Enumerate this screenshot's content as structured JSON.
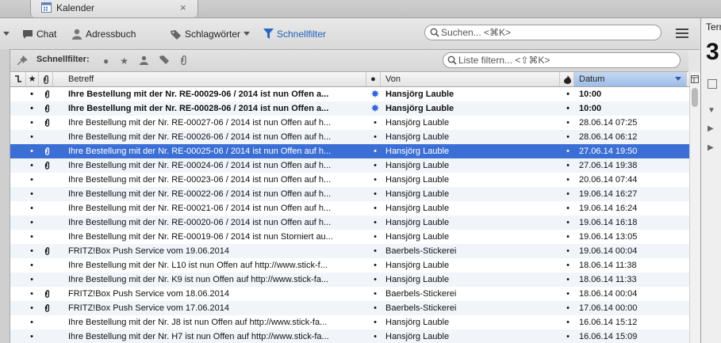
{
  "tab": {
    "title": "Kalender",
    "close": "×",
    "icon": "calendar-icon"
  },
  "toolbar": {
    "chat": "Chat",
    "addressbook": "Adressbuch",
    "tags": "Schlagwörter",
    "quickfilter": "Schnellfilter",
    "search_placeholder": "Suchen... <⌘K>"
  },
  "quickfilter_bar": {
    "label": "Schnellfilter:",
    "filter_placeholder": "Liste filtern... <⇧⌘K>"
  },
  "columns": {
    "subject": "Betreff",
    "from": "Von",
    "date": "Datum"
  },
  "colors": {
    "selection": "#3b6fd6",
    "accent": "#1f5fb8",
    "sorted_header": "#9dbde8"
  },
  "messages": [
    {
      "subject": "Ihre Bestellung mit der Nr. RE-00029-06 / 2014 ist nun Offen a...",
      "from": "Hansjörg Lauble",
      "date": "10:00",
      "bold": true,
      "attachment": true,
      "star": true
    },
    {
      "subject": "Ihre Bestellung mit der Nr. RE-00028-06 / 2014 ist nun Offen a...",
      "from": "Hansjörg Lauble",
      "date": "10:00",
      "bold": true,
      "attachment": true,
      "star": true
    },
    {
      "subject": "Ihre Bestellung mit der Nr. RE-00027-06 / 2014 ist nun Offen auf h...",
      "from": "Hansjörg Lauble",
      "date": "28.06.14 07:25",
      "attachment": true
    },
    {
      "subject": "Ihre Bestellung mit der Nr. RE-00026-06 / 2014 ist nun Offen auf h...",
      "from": "Hansjörg Lauble",
      "date": "28.06.14 06:12"
    },
    {
      "subject": "Ihre Bestellung mit der Nr. RE-00025-06 / 2014 ist nun Offen auf h...",
      "from": "Hansjörg Lauble",
      "date": "27.06.14 19:50",
      "attachment": true,
      "selected": true
    },
    {
      "subject": "Ihre Bestellung mit der Nr. RE-00024-06 / 2014 ist nun Offen auf h...",
      "from": "Hansjörg Lauble",
      "date": "27.06.14 19:38",
      "attachment": true
    },
    {
      "subject": "Ihre Bestellung mit der Nr. RE-00023-06 / 2014 ist nun Offen auf h...",
      "from": "Hansjörg Lauble",
      "date": "20.06.14 07:44"
    },
    {
      "subject": "Ihre Bestellung mit der Nr. RE-00022-06 / 2014 ist nun Offen auf h...",
      "from": "Hansjörg Lauble",
      "date": "19.06.14 16:27"
    },
    {
      "subject": "Ihre Bestellung mit der Nr. RE-00021-06 / 2014 ist nun Offen auf h...",
      "from": "Hansjörg Lauble",
      "date": "19.06.14 16:24"
    },
    {
      "subject": "Ihre Bestellung mit der Nr. RE-00020-06 / 2014 ist nun Offen auf h...",
      "from": "Hansjörg Lauble",
      "date": "19.06.14 16:18"
    },
    {
      "subject": "Ihre Bestellung mit der Nr. RE-00019-06 / 2014 ist nun Storniert au...",
      "from": "Hansjörg Lauble",
      "date": "19.06.14 13:05"
    },
    {
      "subject": "FRITZ!Box Push Service vom 19.06.2014",
      "from": "Baerbels-Stickerei",
      "date": "19.06.14 00:04",
      "attachment": true
    },
    {
      "subject": "Ihre Bestellung mit der Nr. L10 ist nun Offen auf http://www.stick-f...",
      "from": "Hansjörg Lauble",
      "date": "18.06.14 11:38"
    },
    {
      "subject": "Ihre Bestellung mit der Nr. K9 ist nun Offen auf http://www.stick-fa...",
      "from": "Hansjörg Lauble",
      "date": "18.06.14 11:33"
    },
    {
      "subject": "FRITZ!Box Push Service vom 18.06.2014",
      "from": "Baerbels-Stickerei",
      "date": "18.06.14 00:04",
      "attachment": true
    },
    {
      "subject": "FRITZ!Box Push Service vom 17.06.2014",
      "from": "Baerbels-Stickerei",
      "date": "17.06.14 00:00",
      "attachment": true
    },
    {
      "subject": "Ihre Bestellung mit der Nr. J8 ist nun Offen auf http://www.stick-fa...",
      "from": "Hansjörg Lauble",
      "date": "16.06.14 15:12"
    },
    {
      "subject": "Ihre Bestellung mit der Nr. H7 ist nun Offen auf http://www.stick-fa...",
      "from": "Hansjörg Lauble",
      "date": "16.06.14 15:09"
    }
  ],
  "right_panel": {
    "title": "Term",
    "big": "3"
  }
}
